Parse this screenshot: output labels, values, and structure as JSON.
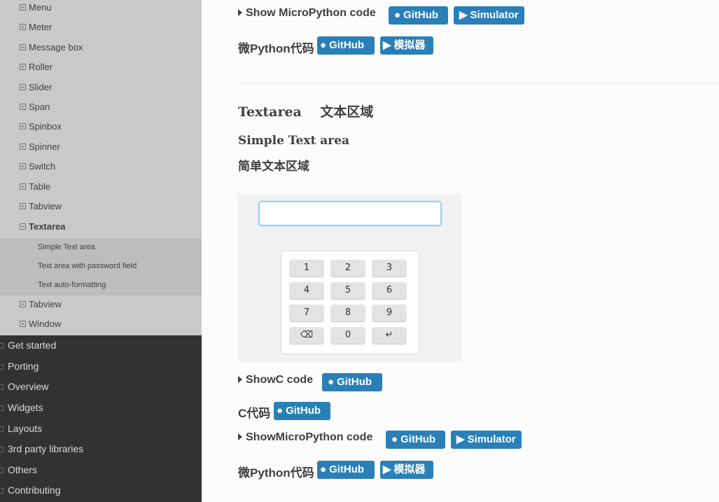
{
  "sidebar": {
    "widget_items": [
      "Menu",
      "Meter",
      "Message box",
      "Roller",
      "Slider",
      "Span",
      "Spinbox",
      "Spinner",
      "Switch",
      "Table",
      "Tabview"
    ],
    "current": "Textarea",
    "current_sub": [
      "Simple Text area",
      "Text area with password field",
      "Text auto-formatting"
    ],
    "after_current": [
      "Tabview",
      "Window"
    ],
    "top_sections": [
      "Get started",
      "Porting",
      "Overview",
      "Widgets",
      "Layouts",
      "3rd party libraries",
      "Others",
      "Contributing"
    ]
  },
  "top_block": {
    "show_mp_label": "Show MicroPython code",
    "github": "GitHub",
    "simulator": "Simulator",
    "cn_label": "微Python代码",
    "cn_github": "GitHub",
    "cn_sim": "模拟器"
  },
  "section": {
    "title_en": "Textarea",
    "title_cn": "文本区域",
    "example_en": "Simple Text area",
    "example_cn": "简单文本区域"
  },
  "keypad": {
    "keys": [
      "1",
      "2",
      "3",
      "4",
      "5",
      "6",
      "7",
      "8",
      "9",
      "⌫",
      "0",
      "↵"
    ]
  },
  "bottom_block": {
    "show_c_label": "ShowC code",
    "c_github": "GitHub",
    "c_cn_label": "C代码",
    "c_cn_github": "GitHub",
    "show_mp_label": "ShowMicroPython code",
    "mp_github": "GitHub",
    "mp_sim": "Simulator",
    "mp_cn_label": "微Python代码",
    "mp_cn_github": "GitHub",
    "mp_cn_sim": "模拟器"
  }
}
